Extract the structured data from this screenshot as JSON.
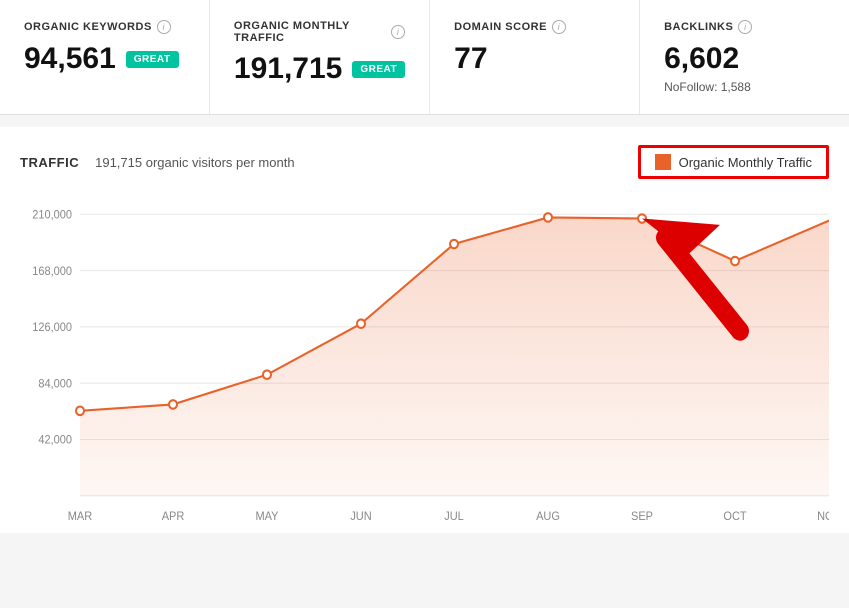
{
  "cards": [
    {
      "id": "organic-keywords",
      "label": "ORGANIC KEYWORDS",
      "value": "94,561",
      "badge": "GREAT",
      "sub": null
    },
    {
      "id": "organic-monthly-traffic",
      "label": "ORGANIC MONTHLY TRAFFIC",
      "value": "191,715",
      "badge": "GREAT",
      "sub": null
    },
    {
      "id": "domain-score",
      "label": "DOMAIN SCORE",
      "value": "77",
      "badge": null,
      "sub": null
    },
    {
      "id": "backlinks",
      "label": "BACKLINKS",
      "value": "6,602",
      "badge": null,
      "sub": "NoFollow: 1,588"
    }
  ],
  "chart": {
    "section_title": "TRAFFIC",
    "subtitle": "191,715 organic visitors per month",
    "legend_label": "Organic Monthly Traffic",
    "y_labels": [
      "210,000",
      "168,000",
      "126,000",
      "84,000",
      "42,000"
    ],
    "x_labels": [
      "MAR",
      "APR",
      "MAY",
      "JUN",
      "JUL",
      "AUG",
      "SEP",
      "OCT",
      "NOV"
    ],
    "line_color": "#e8622a",
    "fill_color": "rgba(232, 98, 42, 0.15)"
  }
}
